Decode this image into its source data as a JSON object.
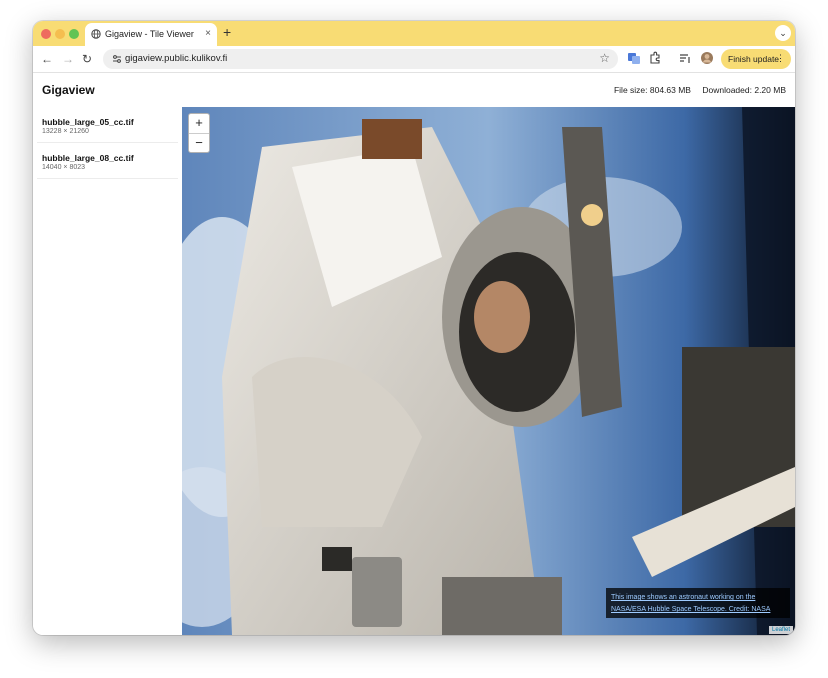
{
  "browser": {
    "tab_title": "Gigaview - Tile Viewer",
    "tab_close": "×",
    "new_tab": "+",
    "tab_menu": "⌄",
    "back": "←",
    "forward": "→",
    "reload": "↻",
    "url": "gigaview.public.kulikov.fi",
    "bookmark": "☆",
    "update_button": "Finish update",
    "menu_dots": "⋮",
    "accent": "#f8dc74"
  },
  "app": {
    "title": "Gigaview",
    "file_size": "File size: 804.63 MB",
    "downloaded": "Downloaded: 2.20 MB"
  },
  "files": [
    {
      "name": "hubble_large_05_cc.tif",
      "dims": "13228 × 21260"
    },
    {
      "name": "hubble_large_08_cc.tif",
      "dims": "14040 × 8023"
    }
  ],
  "viewer": {
    "zoom_in": "+",
    "zoom_out": "−",
    "caption_line1": "This image shows an astronaut working on the",
    "caption_line2": "NASA/ESA Hubble Space Telescope. Credit: NASA",
    "attribution": "Leaflet"
  }
}
